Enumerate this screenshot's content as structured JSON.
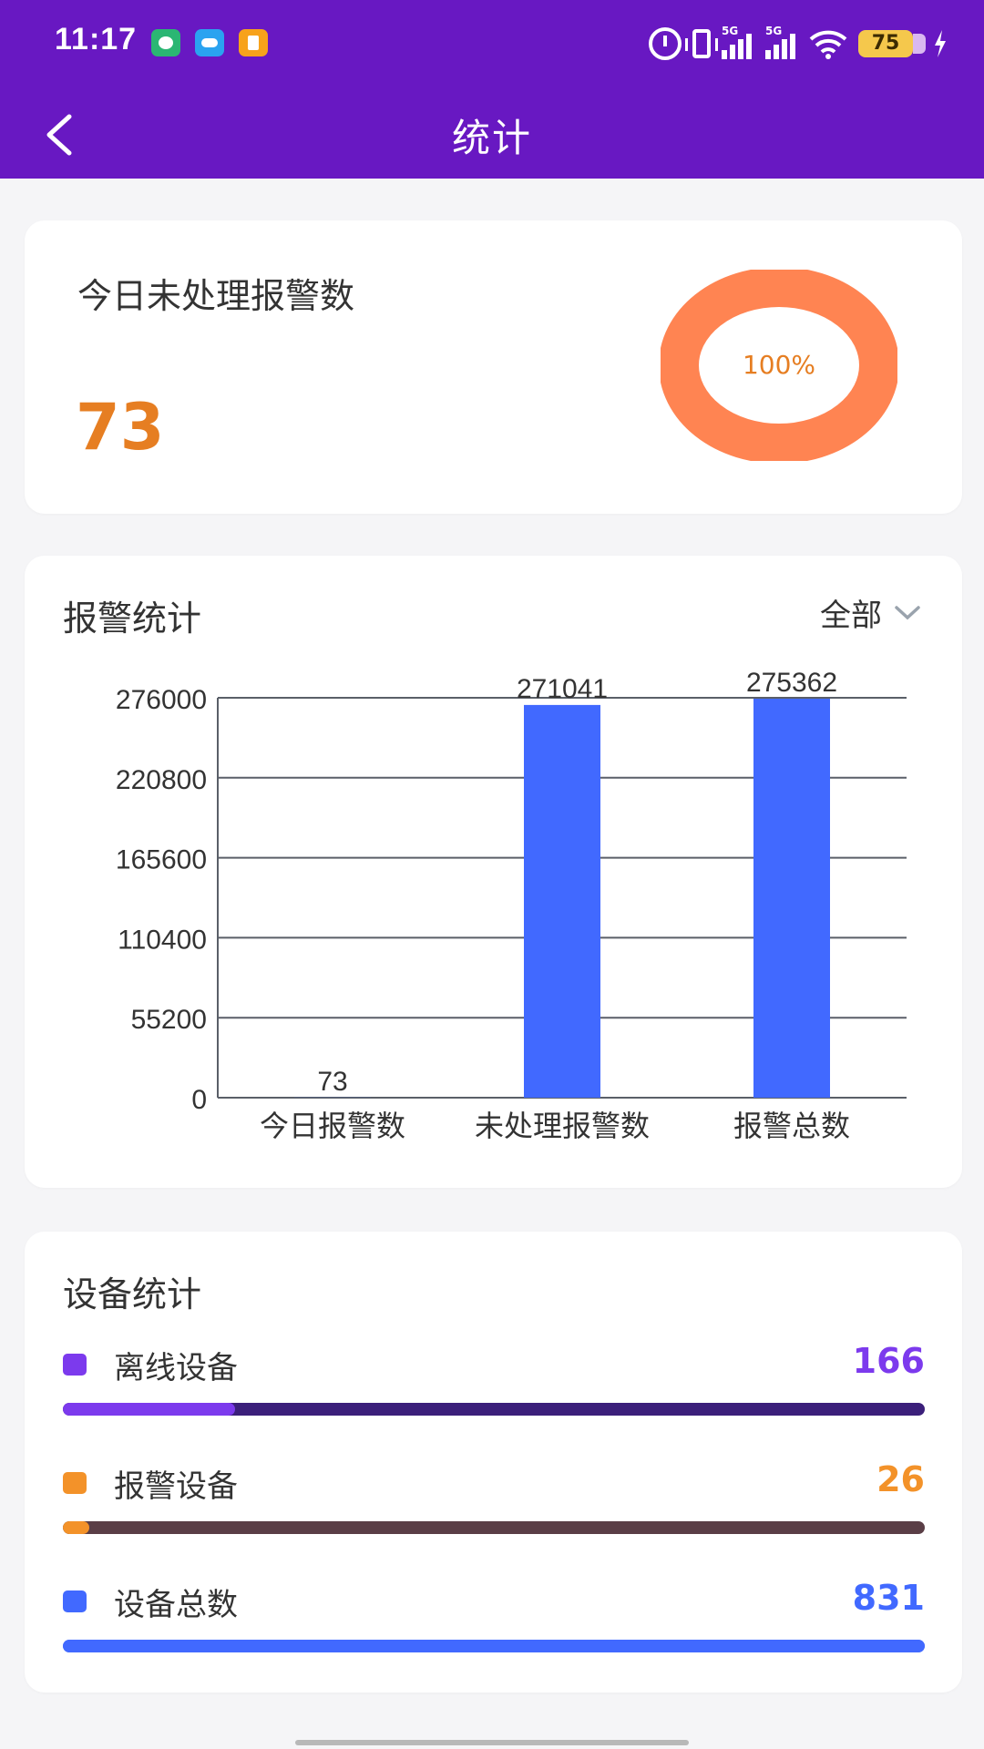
{
  "status_bar": {
    "time": "11:17",
    "battery": "75",
    "signal_label_1": "5G",
    "signal_label_2": "5G"
  },
  "nav": {
    "title": "统计"
  },
  "unprocessed_card": {
    "label": "今日未处理报警数",
    "value": "73",
    "percent_label": "100%",
    "percent": 100
  },
  "alarm_card": {
    "title": "报警统计",
    "filter": "全部"
  },
  "chart_data": {
    "type": "bar",
    "categories": [
      "今日报警数",
      "未处理报警数",
      "报警总数"
    ],
    "values": [
      73,
      271041,
      275362
    ],
    "data_labels": [
      "73",
      "271041",
      "275362"
    ],
    "yticks": [
      "0",
      "55200",
      "110400",
      "165600",
      "220800",
      "276000"
    ],
    "ylim": [
      0,
      276000
    ],
    "grid": true,
    "color": "#4169ff"
  },
  "device_card": {
    "title": "设备统计",
    "rows": [
      {
        "label": "离线设备",
        "value": "166",
        "fraction": 0.2,
        "dot": "#7c3aed",
        "fill": "#7c3aed",
        "track": "#3b1f7a",
        "value_color": "#7c3aed"
      },
      {
        "label": "报警设备",
        "value": "26",
        "fraction": 0.031,
        "dot": "#f39229",
        "fill": "#f39229",
        "track": "#5a3e46",
        "value_color": "#f39229"
      },
      {
        "label": "设备总数",
        "value": "831",
        "fraction": 1.0,
        "dot": "#4169ff",
        "fill": "#4169ff",
        "track": "#4169ff",
        "value_color": "#4169ff"
      }
    ]
  },
  "colors": {
    "header": "#6818c2",
    "accent_orange": "#e67e22",
    "donut": "#ff8452"
  }
}
